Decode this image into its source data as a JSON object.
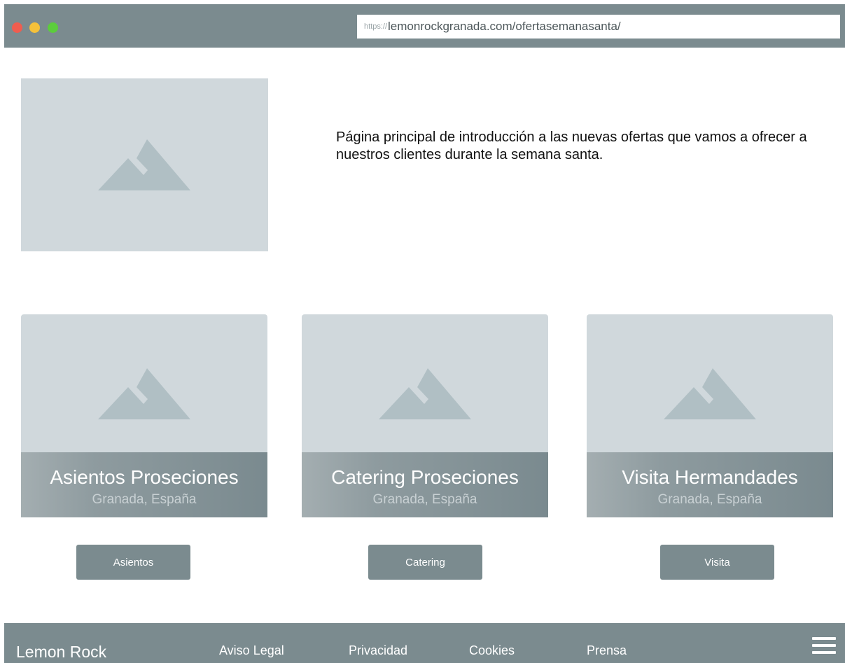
{
  "browser": {
    "url_protocol": "https://",
    "url_path": "lemonrockgranada.com/ofertasemanasanta/"
  },
  "hero": {
    "image_icon": "mountain-image-placeholder-icon",
    "intro_text": "Página principal de introducción a las nuevas ofertas que vamos a ofrecer a nuestros clientes durante la semana santa."
  },
  "cards": [
    {
      "title": "Asientos Proseciones",
      "location": "Granada, España",
      "button_label": "Asientos",
      "image_icon": "mountain-image-placeholder-icon"
    },
    {
      "title": "Catering Proseciones",
      "location": "Granada, España",
      "button_label": "Catering",
      "image_icon": "mountain-image-placeholder-icon"
    },
    {
      "title": "Visita Hermandades",
      "location": "Granada, España",
      "button_label": "Visita",
      "image_icon": "mountain-image-placeholder-icon"
    }
  ],
  "footer": {
    "brand": "Lemon Rock",
    "links": [
      "Aviso Legal",
      "Privacidad",
      "Cookies",
      "Prensa"
    ],
    "menu_icon": "hamburger-menu-icon"
  },
  "colors": {
    "chrome": "#7b8b8f",
    "placeholder": "#d0d8dc",
    "mountain": "#b0bfc4",
    "dot_red": "#ef5d4f",
    "dot_yellow": "#f5c13a",
    "dot_green": "#5ccc3c"
  }
}
